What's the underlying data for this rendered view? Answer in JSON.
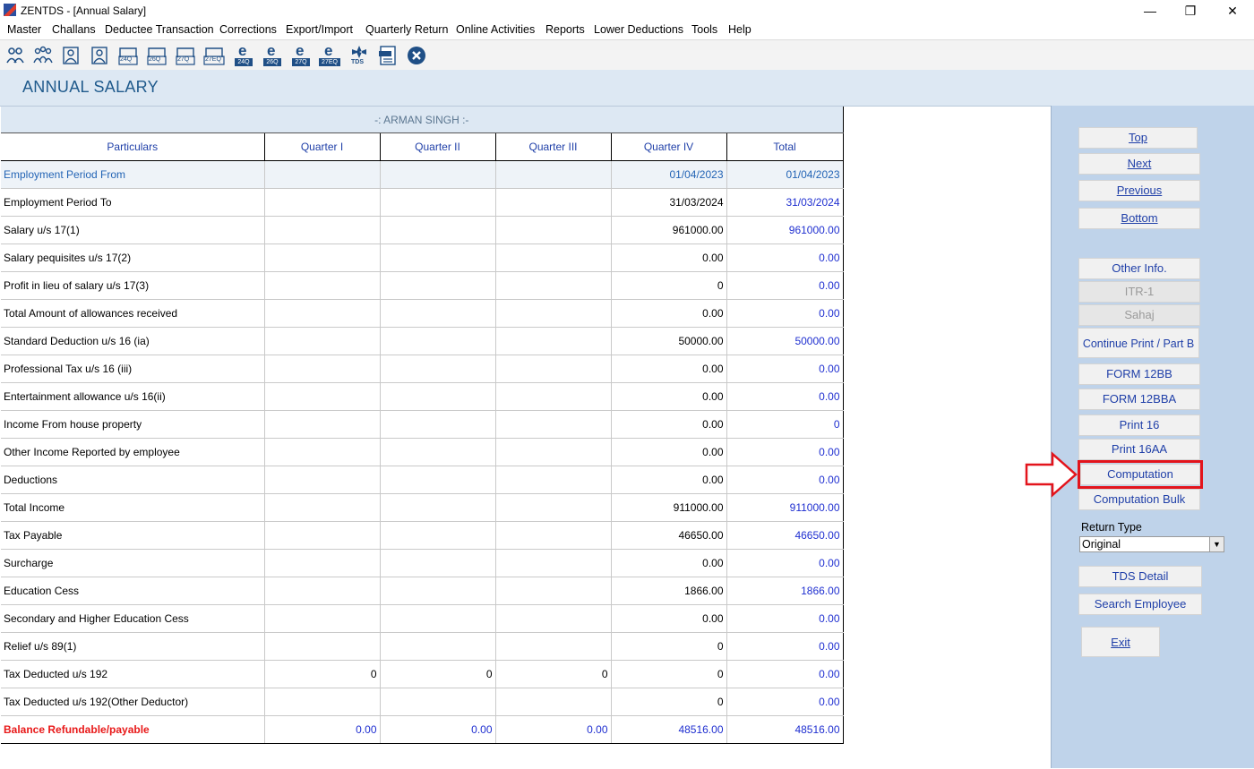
{
  "window": {
    "title": "ZENTDS - [Annual Salary]",
    "minimize": "—",
    "maximize": "❐",
    "close": "✕"
  },
  "menu": [
    "Master",
    "Challans",
    "Deductee Transaction",
    "Corrections",
    "Export/Import",
    "Quarterly Return",
    "Online Activities",
    "Reports",
    "Lower Deductions",
    "Tools",
    "Help"
  ],
  "toolbar": {
    "labels": [
      "24Q",
      "26Q",
      "27Q",
      "27EQ",
      "24Q",
      "26Q",
      "27Q",
      "27EQ",
      "TDS"
    ],
    "icons": [
      "deductor-icon",
      "deductees-icon",
      "user-icon",
      "user-icon",
      "form-24q-icon",
      "form-26q-icon",
      "form-27q-icon",
      "form-27eq-icon",
      "e-24q-icon",
      "e-26q-icon",
      "e-27q-icon",
      "e-27eq-icon",
      "tds-icon",
      "pdf-icon",
      "close-circle-icon"
    ]
  },
  "page": {
    "title": "ANNUAL SALARY"
  },
  "employee": {
    "name": "-: ARMAN SINGH :-"
  },
  "columns": [
    "Particulars",
    "Quarter I",
    "Quarter II",
    "Quarter III",
    "Quarter IV",
    "Total"
  ],
  "rows": [
    {
      "label": "Employment Period From",
      "q1": "",
      "q2": "",
      "q3": "",
      "q4": "01/04/2023",
      "total": "01/04/2023"
    },
    {
      "label": "Employment Period To",
      "q1": "",
      "q2": "",
      "q3": "",
      "q4": "31/03/2024",
      "total": "31/03/2024"
    },
    {
      "label": "Salary u/s 17(1)",
      "q1": "",
      "q2": "",
      "q3": "",
      "q4": "961000.00",
      "total": "961000.00"
    },
    {
      "label": "Salary pequisites u/s 17(2)",
      "q1": "",
      "q2": "",
      "q3": "",
      "q4": "0.00",
      "total": "0.00"
    },
    {
      "label": "Profit in lieu of salary u/s 17(3)",
      "q1": "",
      "q2": "",
      "q3": "",
      "q4": "0",
      "total": "0.00"
    },
    {
      "label": "Total Amount of allowances received",
      "q1": "",
      "q2": "",
      "q3": "",
      "q4": "0.00",
      "total": "0.00"
    },
    {
      "label": "Standard Deduction u/s 16 (ia)",
      "q1": "",
      "q2": "",
      "q3": "",
      "q4": "50000.00",
      "total": "50000.00"
    },
    {
      "label": "Professional Tax u/s 16 (iii)",
      "q1": "",
      "q2": "",
      "q3": "",
      "q4": "0.00",
      "total": "0.00"
    },
    {
      "label": "Entertainment allowance u/s 16(ii)",
      "q1": "",
      "q2": "",
      "q3": "",
      "q4": "0.00",
      "total": "0.00"
    },
    {
      "label": "Income From house property",
      "q1": "",
      "q2": "",
      "q3": "",
      "q4": "0.00",
      "total": "0"
    },
    {
      "label": "Other Income Reported by employee",
      "q1": "",
      "q2": "",
      "q3": "",
      "q4": "0.00",
      "total": "0.00"
    },
    {
      "label": "Deductions",
      "q1": "",
      "q2": "",
      "q3": "",
      "q4": "0.00",
      "total": "0.00"
    },
    {
      "label": "Total Income",
      "q1": "",
      "q2": "",
      "q3": "",
      "q4": "911000.00",
      "total": "911000.00"
    },
    {
      "label": "Tax Payable",
      "q1": "",
      "q2": "",
      "q3": "",
      "q4": "46650.00",
      "total": "46650.00"
    },
    {
      "label": "Surcharge",
      "q1": "",
      "q2": "",
      "q3": "",
      "q4": "0.00",
      "total": "0.00"
    },
    {
      "label": "Education Cess",
      "q1": "",
      "q2": "",
      "q3": "",
      "q4": "1866.00",
      "total": "1866.00"
    },
    {
      "label": "Secondary and Higher Education Cess",
      "q1": "",
      "q2": "",
      "q3": "",
      "q4": "0.00",
      "total": "0.00"
    },
    {
      "label": "Relief u/s 89(1)",
      "q1": "",
      "q2": "",
      "q3": "",
      "q4": "0",
      "total": "0.00"
    },
    {
      "label": "Tax Deducted u/s 192",
      "q1": "0",
      "q2": "0",
      "q3": "0",
      "q4": "0",
      "total": "0.00"
    },
    {
      "label": "Tax Deducted u/s 192(Other Deductor)",
      "q1": "",
      "q2": "",
      "q3": "",
      "q4": "0",
      "total": "0.00"
    },
    {
      "label": "Balance Refundable/payable",
      "q1": "0.00",
      "q2": "0.00",
      "q3": "0.00",
      "q4": "48516.00",
      "total": "48516.00"
    }
  ],
  "side": {
    "top": "Top",
    "next": "Next",
    "previous": "Previous",
    "bottom": "Bottom",
    "other_info": "Other Info.",
    "itr1": "ITR-1",
    "sahaj": "Sahaj",
    "continue_print": "Continue Print / Part B",
    "form12bb": "FORM 12BB",
    "form12bba": "FORM 12BBA",
    "print16": "Print 16",
    "print16aa": "Print 16AA",
    "computation": "Computation",
    "computation_bulk": "Computation Bulk",
    "return_type_label": "Return Type",
    "return_type_value": "Original",
    "tds_detail": "TDS Detail",
    "search_employee": "Search Employee",
    "exit": "Exit"
  },
  "colors": {
    "accent": "#1f3fa8",
    "highlight": "#e3141c",
    "panel": "#bfd3ea",
    "header_band": "#dde8f3"
  }
}
